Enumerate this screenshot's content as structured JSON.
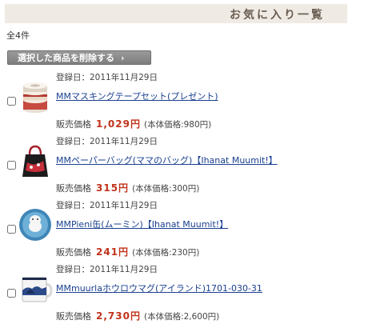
{
  "header": {
    "title": "お気に入り一覧"
  },
  "count_text": "全4件",
  "delete_button": {
    "label": "選択した商品を削除する",
    "chevron": "›"
  },
  "items": [
    {
      "date": "登録日：2011年11月29日",
      "name": "MMマスキングテープセット(プレゼント)",
      "price_label": "販売価格",
      "price": "1,029円",
      "price_note": "(本体価格:980円)",
      "icon": "masking-tape-icon"
    },
    {
      "date": "登録日：2011年11月29日",
      "name": "MMペーパーバッグ(ママのバッグ)【Ihanat Muumit!】",
      "price_label": "販売価格",
      "price": "315円",
      "price_note": "(本体価格:300円)",
      "icon": "paper-bag-icon"
    },
    {
      "date": "登録日：2011年11月29日",
      "name": "MMPieni缶(ムーミン)【Ihanat Muumit!】",
      "price_label": "販売価格",
      "price": "241円",
      "price_note": "(本体価格:230円)",
      "icon": "tin-can-icon"
    },
    {
      "date": "登録日：2011年11月29日",
      "name": "MMmuurlaホウロウマグ(アイランド)1701-030-31",
      "price_label": "販売価格",
      "price": "2,730円",
      "price_note": "(本体価格:2,600円)",
      "icon": "enamel-mug-icon"
    }
  ],
  "colors": {
    "header_bg": "#efebe4",
    "header_text": "#6b5e52",
    "price": "#c0331b",
    "link": "#1a3f8f",
    "button_bg": "#8a8a8a"
  }
}
